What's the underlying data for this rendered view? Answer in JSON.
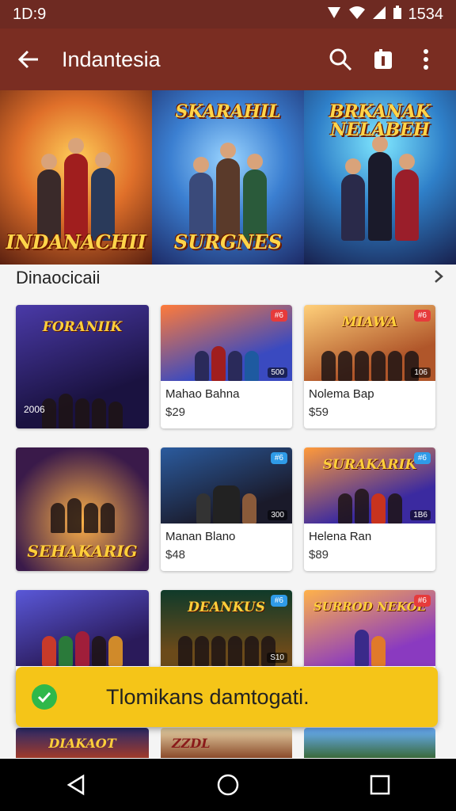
{
  "status_bar": {
    "time": "1D:9",
    "clock": "1534"
  },
  "app_bar": {
    "title": "Indantesia"
  },
  "banners": [
    {
      "title_top": "",
      "title_bottom": "INDANACHII"
    },
    {
      "title_top": "SKARAHIL",
      "title_bottom": "SURGNES"
    },
    {
      "title_top": "BRKANAK NELABEH",
      "title_bottom": ""
    }
  ],
  "section": {
    "label": "Dinaocicaii"
  },
  "cards": [
    {
      "art_title": "FORANIIK",
      "corner": "2006",
      "name": "",
      "price": ""
    },
    {
      "art_title": "",
      "badge": "#6",
      "corner": "500",
      "name": "Mahao Bahna",
      "price": "$29"
    },
    {
      "art_title": "MIAWA",
      "badge": "#6",
      "corner": "106",
      "name": "Nolema Bap",
      "price": "$59"
    },
    {
      "art_title": "SEHAKARIG",
      "corner": "",
      "name": "",
      "price": ""
    },
    {
      "art_title": "",
      "badge": "#6",
      "corner": "300",
      "name": "Manan Blano",
      "price": "$48"
    },
    {
      "art_title": "SURAKARIK",
      "badge": "#6",
      "corner": "1B6",
      "name": "Helena Ran",
      "price": "$89"
    },
    {
      "art_title": "",
      "corner": "",
      "name": "",
      "price": ""
    },
    {
      "art_title": "DEANKUS",
      "badge": "#6",
      "corner": "S10",
      "name": "",
      "price": ""
    },
    {
      "art_title": "SURROD NEKOE",
      "badge": "#6",
      "corner": "",
      "name": "",
      "price": ""
    }
  ],
  "peek": [
    "DIAKAOT",
    "ZZDL",
    ""
  ],
  "toast": {
    "message": "Tlomikans damtogati."
  }
}
